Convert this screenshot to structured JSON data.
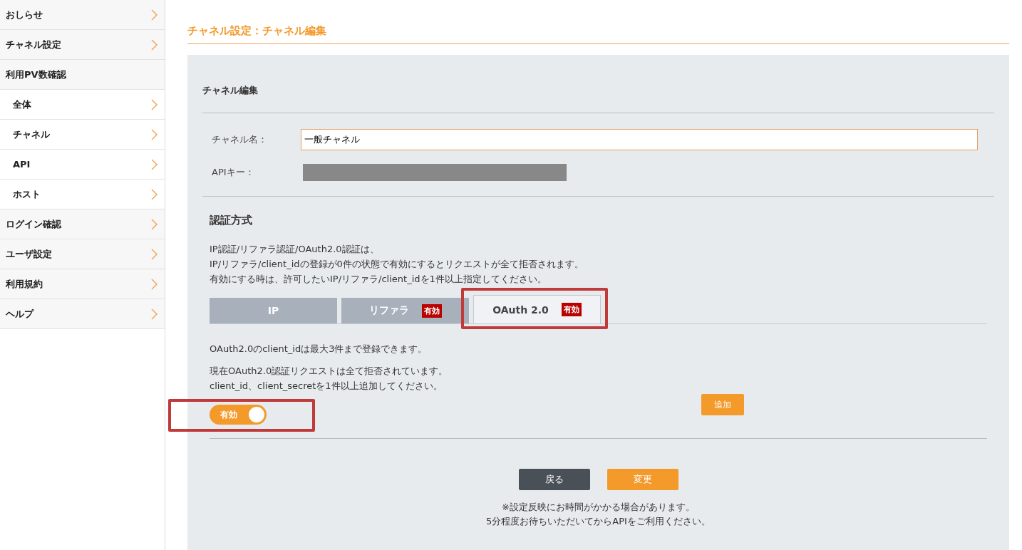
{
  "sidebar": {
    "items": [
      {
        "label": "おしらせ",
        "selected": false
      },
      {
        "label": "チャネル設定",
        "selected": false
      },
      {
        "label": "利用PV数確認",
        "selected": false,
        "children": [
          {
            "label": "全体",
            "selected": false
          },
          {
            "label": "チャネル",
            "selected": false
          },
          {
            "label": "API",
            "selected": false
          },
          {
            "label": "ホスト",
            "selected": false
          }
        ]
      },
      {
        "label": "ログイン確認",
        "selected": false
      },
      {
        "label": "ユーザ設定",
        "selected": false
      },
      {
        "label": "利用規約",
        "selected": false
      },
      {
        "label": "ヘルプ",
        "selected": false
      }
    ]
  },
  "page_title": "チャネル設定：チャネル編集",
  "panel": {
    "title": "チャネル編集",
    "fields": [
      {
        "kind": "input",
        "label": "チャネル名：",
        "value": "一般チャネル"
      },
      {
        "kind": "redacted",
        "label": "APIキー："
      }
    ],
    "auth": {
      "heading": "認証方式",
      "description": [
        "IP認証/リファラ認証/OAuth2.0認証は、",
        "IP/リファラ/client_idの登録が0件の状態で有効にするとリクエストが全て拒否されます。",
        "有効にする時は、許可したいIP/リファラ/client_idを1件以上指定してください。"
      ],
      "tabs": [
        {
          "label": "IP",
          "selected": false
        },
        {
          "label": "リファラ",
          "selected": false,
          "badge": "有効"
        },
        {
          "label": "OAuth 2.0",
          "selected": true,
          "badge": "有効"
        }
      ],
      "limit_note": "OAuth2.0のclient_idは最大3件まで登録できます。",
      "warning": [
        "現在OAuth2.0認証リクエストは全て拒否されています。",
        "client_id、client_secretを1件以上追加してください。"
      ],
      "toggle": {
        "label": "有効",
        "on": true
      },
      "add_button": "追加"
    },
    "buttons": [
      {
        "kind": "back",
        "label": "戻る"
      },
      {
        "kind": "submit",
        "label": "変更"
      }
    ],
    "notes": [
      "※設定反映にお時間がかかる場合があります。",
      "5分程度お待ちいただいてからAPIをご利用ください。"
    ]
  }
}
